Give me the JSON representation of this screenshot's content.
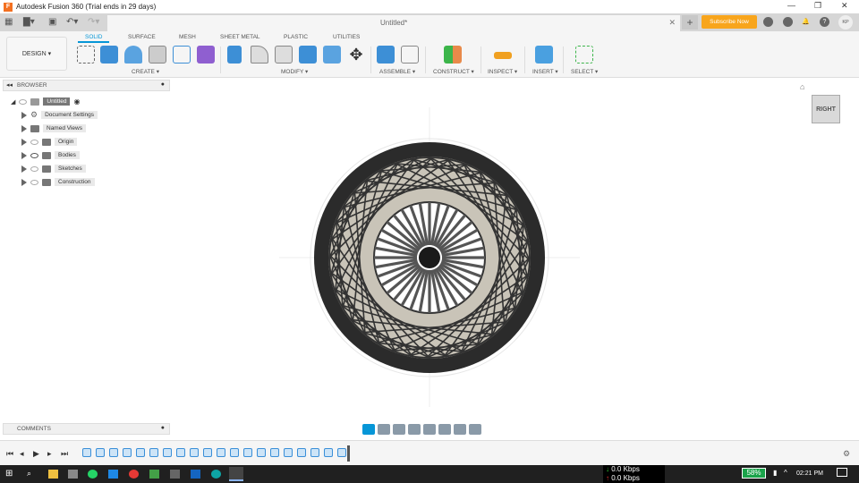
{
  "window": {
    "title": "Autodesk Fusion 360 (Trial ends in 29 days)",
    "logo": "F"
  },
  "document": {
    "tab_name": "Untitled*"
  },
  "header": {
    "subscribe": "Subscribe Now",
    "avatar": "KP"
  },
  "workspace": {
    "label": "DESIGN ▾"
  },
  "tabs": [
    "SOLID",
    "SURFACE",
    "MESH",
    "SHEET METAL",
    "PLASTIC",
    "UTILITIES"
  ],
  "groups": [
    "CREATE ▾",
    "MODIFY ▾",
    "ASSEMBLE ▾",
    "CONSTRUCT ▾",
    "INSPECT ▾",
    "INSERT ▾",
    "SELECT ▾"
  ],
  "browser": {
    "title": "BROWSER",
    "root": "Untitled",
    "items": [
      "Document Settings",
      "Named Views",
      "Origin",
      "Bodies",
      "Sketches",
      "Construction"
    ]
  },
  "comments": {
    "title": "COMMENTS"
  },
  "viewcube": {
    "face": "RIGHT"
  },
  "taskbar": {
    "down": "0.0 Kbps",
    "up": "0.0 Kbps",
    "battery": "58%",
    "time": "02:21 PM"
  },
  "colors": {
    "accent": "#0696d7",
    "subscribe": "#f8a51c"
  }
}
